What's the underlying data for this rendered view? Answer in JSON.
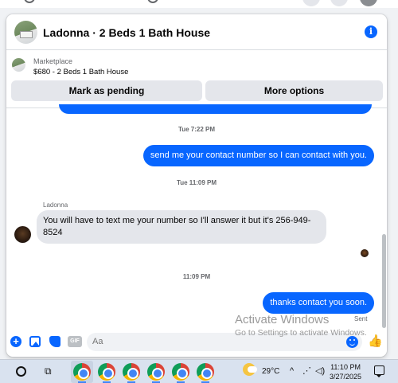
{
  "chat": {
    "title": "Ladonna · 2 Beds 1 Bath House",
    "listing": {
      "source": "Marketplace",
      "summary": "$680 - 2 Beds 1 Bath House"
    },
    "buttons": {
      "pending": "Mark as pending",
      "more": "More options"
    },
    "messages": [
      {
        "timestamp": "Tue 7:22 PM"
      },
      {
        "from": "me",
        "text": "send me your contact number so I can contact with you."
      },
      {
        "timestamp": "Tue 11:09 PM"
      },
      {
        "sender": "Ladonna",
        "from": "them",
        "text": "You will have to text me your number so I'll answer it but it's 256-949-8524"
      },
      {
        "timestamp": "11:09 PM"
      },
      {
        "from": "me",
        "text": "thanks contact you soon.",
        "status": "Sent"
      }
    ],
    "composer": {
      "placeholder": "Aa",
      "gif_label": "GIF"
    }
  },
  "watermark": {
    "line1": "Activate Windows",
    "line2": "Go to Settings to activate Windows."
  },
  "taskbar": {
    "temperature": "29°C",
    "time": "11:10 PM",
    "date": "3/27/2025"
  },
  "colors": {
    "messenger_blue": "#0866ff",
    "bubble_gray": "#e4e6eb",
    "taskbar": "#d9e2ef"
  }
}
